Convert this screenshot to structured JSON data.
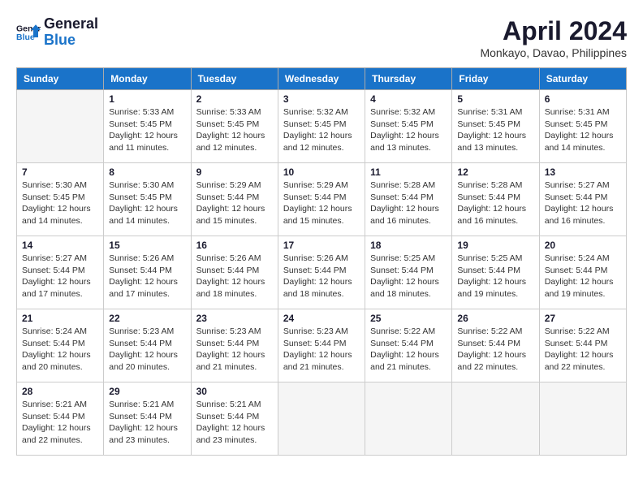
{
  "header": {
    "logo_line1": "General",
    "logo_line2": "Blue",
    "month_year": "April 2024",
    "location": "Monkayo, Davao, Philippines"
  },
  "days_of_week": [
    "Sunday",
    "Monday",
    "Tuesday",
    "Wednesday",
    "Thursday",
    "Friday",
    "Saturday"
  ],
  "weeks": [
    [
      {
        "day": "",
        "empty": true
      },
      {
        "day": "1",
        "sunrise": "5:33 AM",
        "sunset": "5:45 PM",
        "daylight": "12 hours and 11 minutes."
      },
      {
        "day": "2",
        "sunrise": "5:33 AM",
        "sunset": "5:45 PM",
        "daylight": "12 hours and 12 minutes."
      },
      {
        "day": "3",
        "sunrise": "5:32 AM",
        "sunset": "5:45 PM",
        "daylight": "12 hours and 12 minutes."
      },
      {
        "day": "4",
        "sunrise": "5:32 AM",
        "sunset": "5:45 PM",
        "daylight": "12 hours and 13 minutes."
      },
      {
        "day": "5",
        "sunrise": "5:31 AM",
        "sunset": "5:45 PM",
        "daylight": "12 hours and 13 minutes."
      },
      {
        "day": "6",
        "sunrise": "5:31 AM",
        "sunset": "5:45 PM",
        "daylight": "12 hours and 14 minutes."
      }
    ],
    [
      {
        "day": "7",
        "sunrise": "5:30 AM",
        "sunset": "5:45 PM",
        "daylight": "12 hours and 14 minutes."
      },
      {
        "day": "8",
        "sunrise": "5:30 AM",
        "sunset": "5:45 PM",
        "daylight": "12 hours and 14 minutes."
      },
      {
        "day": "9",
        "sunrise": "5:29 AM",
        "sunset": "5:44 PM",
        "daylight": "12 hours and 15 minutes."
      },
      {
        "day": "10",
        "sunrise": "5:29 AM",
        "sunset": "5:44 PM",
        "daylight": "12 hours and 15 minutes."
      },
      {
        "day": "11",
        "sunrise": "5:28 AM",
        "sunset": "5:44 PM",
        "daylight": "12 hours and 16 minutes."
      },
      {
        "day": "12",
        "sunrise": "5:28 AM",
        "sunset": "5:44 PM",
        "daylight": "12 hours and 16 minutes."
      },
      {
        "day": "13",
        "sunrise": "5:27 AM",
        "sunset": "5:44 PM",
        "daylight": "12 hours and 16 minutes."
      }
    ],
    [
      {
        "day": "14",
        "sunrise": "5:27 AM",
        "sunset": "5:44 PM",
        "daylight": "12 hours and 17 minutes."
      },
      {
        "day": "15",
        "sunrise": "5:26 AM",
        "sunset": "5:44 PM",
        "daylight": "12 hours and 17 minutes."
      },
      {
        "day": "16",
        "sunrise": "5:26 AM",
        "sunset": "5:44 PM",
        "daylight": "12 hours and 18 minutes."
      },
      {
        "day": "17",
        "sunrise": "5:26 AM",
        "sunset": "5:44 PM",
        "daylight": "12 hours and 18 minutes."
      },
      {
        "day": "18",
        "sunrise": "5:25 AM",
        "sunset": "5:44 PM",
        "daylight": "12 hours and 18 minutes."
      },
      {
        "day": "19",
        "sunrise": "5:25 AM",
        "sunset": "5:44 PM",
        "daylight": "12 hours and 19 minutes."
      },
      {
        "day": "20",
        "sunrise": "5:24 AM",
        "sunset": "5:44 PM",
        "daylight": "12 hours and 19 minutes."
      }
    ],
    [
      {
        "day": "21",
        "sunrise": "5:24 AM",
        "sunset": "5:44 PM",
        "daylight": "12 hours and 20 minutes."
      },
      {
        "day": "22",
        "sunrise": "5:23 AM",
        "sunset": "5:44 PM",
        "daylight": "12 hours and 20 minutes."
      },
      {
        "day": "23",
        "sunrise": "5:23 AM",
        "sunset": "5:44 PM",
        "daylight": "12 hours and 21 minutes."
      },
      {
        "day": "24",
        "sunrise": "5:23 AM",
        "sunset": "5:44 PM",
        "daylight": "12 hours and 21 minutes."
      },
      {
        "day": "25",
        "sunrise": "5:22 AM",
        "sunset": "5:44 PM",
        "daylight": "12 hours and 21 minutes."
      },
      {
        "day": "26",
        "sunrise": "5:22 AM",
        "sunset": "5:44 PM",
        "daylight": "12 hours and 22 minutes."
      },
      {
        "day": "27",
        "sunrise": "5:22 AM",
        "sunset": "5:44 PM",
        "daylight": "12 hours and 22 minutes."
      }
    ],
    [
      {
        "day": "28",
        "sunrise": "5:21 AM",
        "sunset": "5:44 PM",
        "daylight": "12 hours and 22 minutes."
      },
      {
        "day": "29",
        "sunrise": "5:21 AM",
        "sunset": "5:44 PM",
        "daylight": "12 hours and 23 minutes."
      },
      {
        "day": "30",
        "sunrise": "5:21 AM",
        "sunset": "5:44 PM",
        "daylight": "12 hours and 23 minutes."
      },
      {
        "day": "",
        "empty": true
      },
      {
        "day": "",
        "empty": true
      },
      {
        "day": "",
        "empty": true
      },
      {
        "day": "",
        "empty": true
      }
    ]
  ],
  "labels": {
    "sunrise_label": "Sunrise:",
    "sunset_label": "Sunset:",
    "daylight_label": "Daylight:"
  }
}
